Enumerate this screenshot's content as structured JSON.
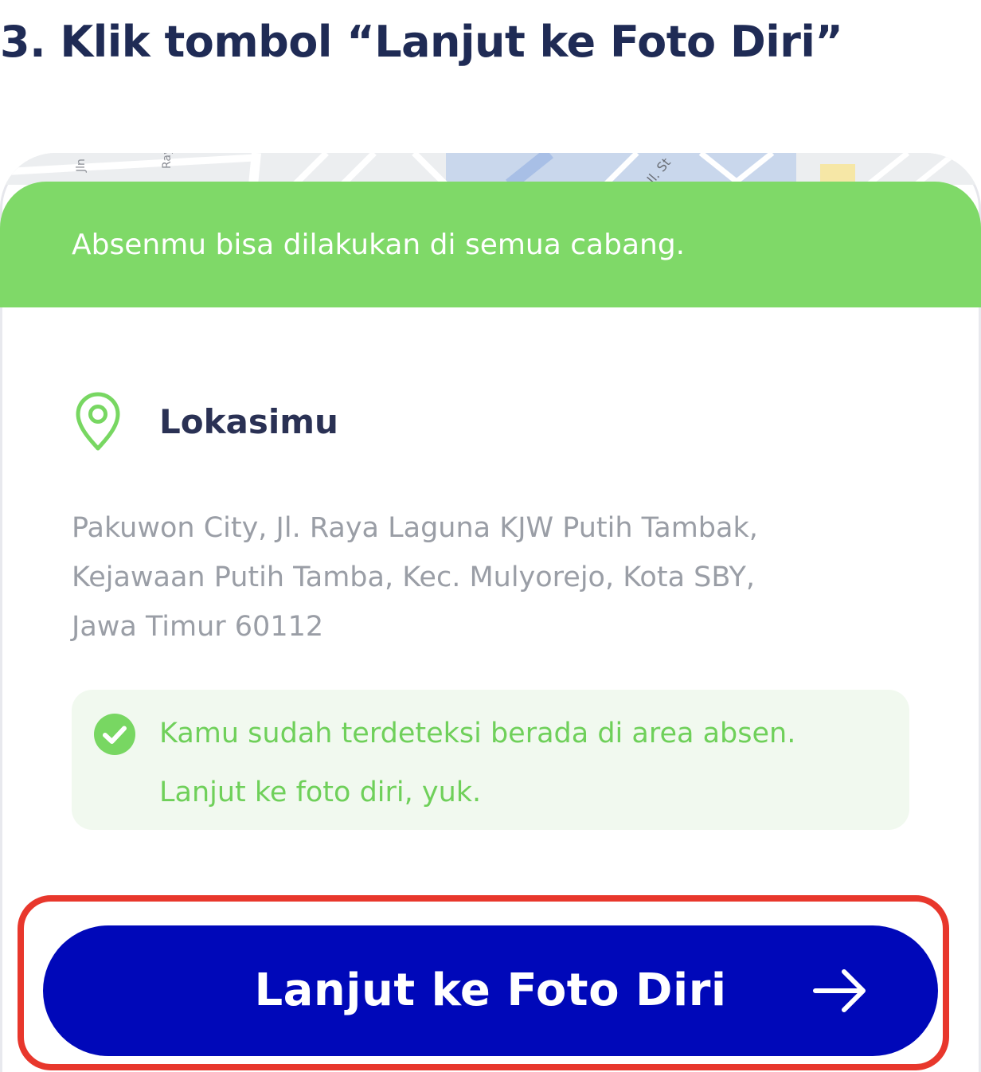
{
  "step": {
    "title": "3. Klik tombol “Lanjut ke Foto Diri”"
  },
  "map": {
    "label_a": "Jln",
    "label_b": "Raya",
    "label_c": "Jl. St"
  },
  "banner": {
    "text": "Absenmu bisa dilakukan di semua cabang."
  },
  "location": {
    "icon": "location-pin-icon",
    "title": "Lokasimu",
    "address_lines": [
      "Pakuwon City, Jl. Raya Laguna KJW Putih Tambak,",
      "Kejawaan Putih Tamba, Kec. Mulyorejo, Kota SBY,",
      "Jawa Timur 60112"
    ]
  },
  "notice": {
    "icon": "check-circle-icon",
    "lines": [
      "Kamu sudah terdeteksi berada di area absen.",
      "Lanjut ke foto diri, yuk."
    ]
  },
  "cta": {
    "label": "Lanjut ke Foto Diri",
    "icon": "arrow-right-icon"
  },
  "colors": {
    "title": "#1f2b55",
    "banner": "#7fd968",
    "primary": "#0008b9",
    "success_text": "#6fd05a",
    "success_bg": "#f1f9ef",
    "highlight": "#e8372c",
    "muted_text": "#9a9ea6"
  }
}
